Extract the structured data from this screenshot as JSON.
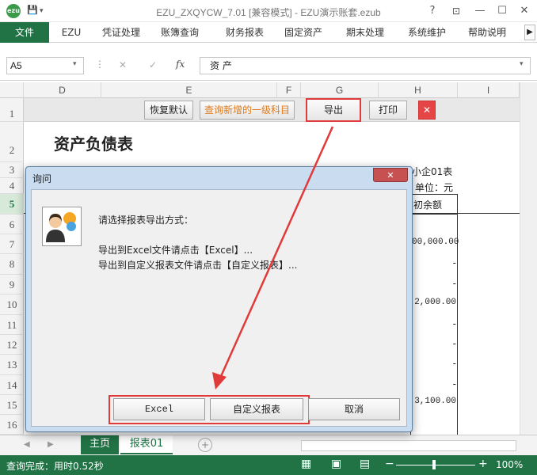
{
  "titlebar": {
    "title": "EZU_ZXQYCW_7.01  [兼容模式] - EZU演示账套.ezub",
    "help": "?",
    "minimize": "—",
    "close": "✕"
  },
  "ribbon": {
    "tabs": [
      "文件",
      "EZU",
      "凭证处理",
      "账簿查询",
      "财务报表",
      "固定资产",
      "期末处理",
      "系统维护",
      "帮助说明"
    ]
  },
  "formula": {
    "cell_ref": "A5",
    "cancel": "✕",
    "enter": "✓",
    "fx": "fx",
    "content": "资   产"
  },
  "columns": [
    "D",
    "E",
    "F",
    "G",
    "H",
    "I"
  ],
  "rows": [
    "1",
    "2",
    "3",
    "4",
    "5",
    "6",
    "7",
    "8",
    "9",
    "10",
    "11",
    "12",
    "13",
    "14",
    "15",
    "16"
  ],
  "toolbar": {
    "restore": "恢复默认",
    "query_new": "查询新增的一级科目",
    "export": "导出",
    "print": "打印",
    "close": "✕"
  },
  "sheet": {
    "title": "资产负债表",
    "form_no": "小企01表",
    "unit": "单位：元",
    "col_header": "初余额",
    "values": [
      "00,000.00",
      "-",
      "-",
      "2,000.00",
      "-",
      "-",
      "-",
      "-",
      "3,100.00"
    ]
  },
  "dialog": {
    "title": "询问",
    "close": "✕",
    "prompt": "请选择报表导出方式：",
    "line1": "导出到Excel文件请点击【Excel】...",
    "line2": "导出到自定义报表文件请点击【自定义报表】...",
    "btn_excel": "Excel",
    "btn_custom": "自定义报表",
    "btn_cancel": "取消"
  },
  "sheets": {
    "tab1": "主页",
    "tab2": "报表01",
    "add": "+"
  },
  "status": {
    "text": "查询完成：用时0.52秒",
    "zoom": "100%"
  },
  "colors": {
    "excel_green": "#217346",
    "highlight_red": "#e03a3a",
    "orange_text": "#e07a1a"
  }
}
